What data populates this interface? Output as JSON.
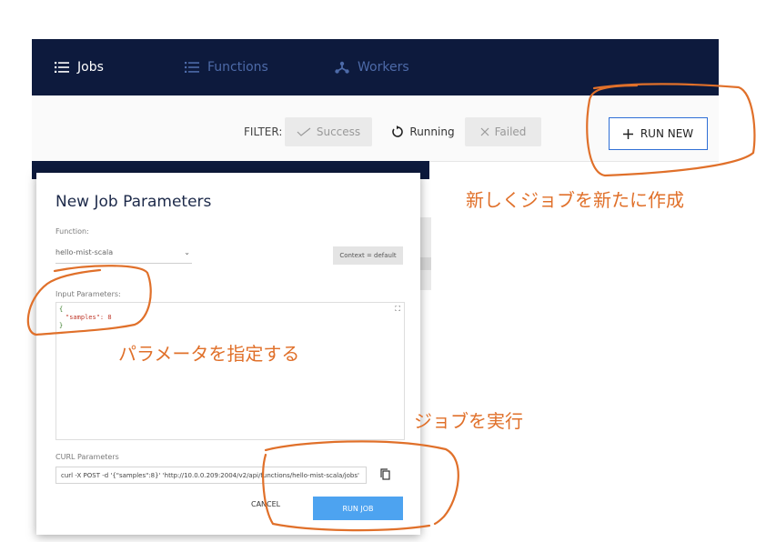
{
  "nav": {
    "tabs": [
      {
        "label": "Jobs",
        "icon": "list-icon",
        "active": true
      },
      {
        "label": "Functions",
        "icon": "list-icon",
        "active": false
      },
      {
        "label": "Workers",
        "icon": "workers-icon",
        "active": false
      }
    ]
  },
  "filter": {
    "label": "FILTER:",
    "options": [
      {
        "label": "Success",
        "icon": "check-icon",
        "selected": false
      },
      {
        "label": "Running",
        "icon": "refresh-icon",
        "selected": true
      },
      {
        "label": "Failed",
        "icon": "x-icon",
        "selected": false
      }
    ],
    "run_new": "RUN NEW"
  },
  "modal": {
    "title": "New Job Parameters",
    "function_label": "Function:",
    "function_value": "hello-mist-scala",
    "context_button": "Context = default",
    "input_label": "Input Parameters:",
    "input_lines": [
      "{",
      "\"samples\": 8",
      "}"
    ],
    "curl_label": "CURL Parameters",
    "curl_value": "curl -X POST -d '{\"samples\":8}' 'http://10.0.0.209:2004/v2/api/functions/hello-mist-scala/jobs'",
    "cancel": "CANCEL",
    "run_job": "RUN JOB"
  },
  "annotations": {
    "create_new_job": "新しくジョブを新たに作成",
    "specify_params": "パラメータを指定する",
    "run_job": "ジョブを実行",
    "color": "#e0702a"
  },
  "colors": {
    "nav_bg": "#0d1a3d",
    "accent": "#4da3f0",
    "run_new_border": "#2f6fd6"
  }
}
